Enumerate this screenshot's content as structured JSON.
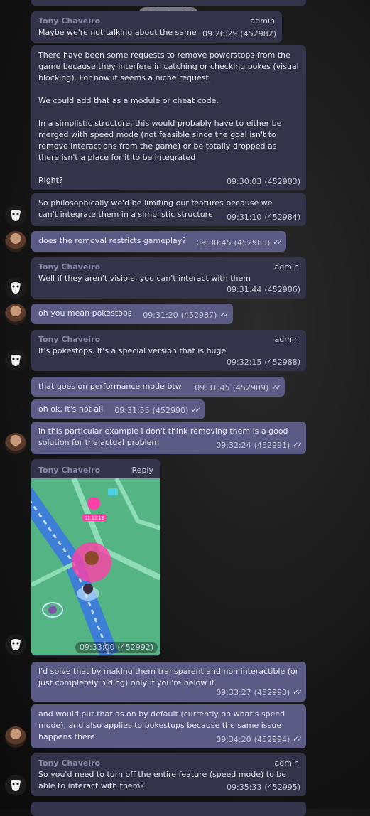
{
  "date_header": "October 18",
  "messages": [
    {
      "author": "Tony Chaveiro",
      "role": "admin",
      "text": "Maybe we're not talking about the same",
      "time": "09:26:29",
      "id": "(452982)"
    },
    {
      "author": "",
      "role": "",
      "text": "There have been some requests to remove powerstops from the game because they interfere in catching or checking pokes (visual blocking). For now it seems a niche request.\n\nWe could add that as a module or cheat code.\n\nIn a simplistic structure, this would probably have to either be merged with speed mode (not feasible since the goal isn't to remove interactions from the game) or be totally dropped as there isn't a place for it to be integrated\n\nRight?",
      "time": "09:30:03",
      "id": "(452983)"
    },
    {
      "author": "",
      "role": "",
      "text": "So philosophically we'd be limiting our features because we can't integrate them in a simplistic structure",
      "time": "09:31:10",
      "id": "(452984)"
    },
    {
      "author": "",
      "role": "",
      "text": "does the removal restricts gameplay?",
      "time": "09:30:45",
      "id": "(452985)"
    },
    {
      "author": "Tony Chaveiro",
      "role": "admin",
      "text": "Well if they aren't visible, you can't interact with them",
      "time": "09:31:44",
      "id": "(452986)"
    },
    {
      "author": "",
      "role": "",
      "text": "oh you mean pokestops",
      "time": "09:31:20",
      "id": "(452987)"
    },
    {
      "author": "Tony Chaveiro",
      "role": "admin",
      "text": "It's pokestops. It's a special version that is huge",
      "time": "09:32:15",
      "id": "(452988)"
    },
    {
      "author": "",
      "role": "",
      "text": "that goes on performance mode btw",
      "time": "09:31:45",
      "id": "(452989)"
    },
    {
      "author": "",
      "role": "",
      "text": "oh ok, it's not all",
      "time": "09:31:55",
      "id": "(452990)"
    },
    {
      "author": "",
      "role": "",
      "text": "in this particular example I don't think removing them is a good solution for the actual problem",
      "time": "09:32:24",
      "id": "(452991)"
    },
    {
      "author": "Tony Chaveiro",
      "role": "Reply",
      "text": "",
      "time": "09:33:00",
      "id": "(452992)",
      "map_label": "11:12:19"
    },
    {
      "author": "",
      "role": "",
      "text": "I'd solve that by making them transparent and non interactible (or just completely hiding) only if you're below it",
      "time": "09:33:27",
      "id": "(452993)"
    },
    {
      "author": "",
      "role": "",
      "text": "and would put that as on by default (currently on what's speed mode), and also applies to pokestops because the same issue happens there",
      "time": "09:34:20",
      "id": "(452994)"
    },
    {
      "author": "Tony Chaveiro",
      "role": "admin",
      "text": "So you'd need to turn off the entire feature (speed mode) to be able to interact with them?",
      "time": "09:35:33",
      "id": "(452995)"
    }
  ],
  "colors": {
    "incoming": "#33334a",
    "outgoing": "#5b5b86",
    "name": "#8a8aaa"
  }
}
